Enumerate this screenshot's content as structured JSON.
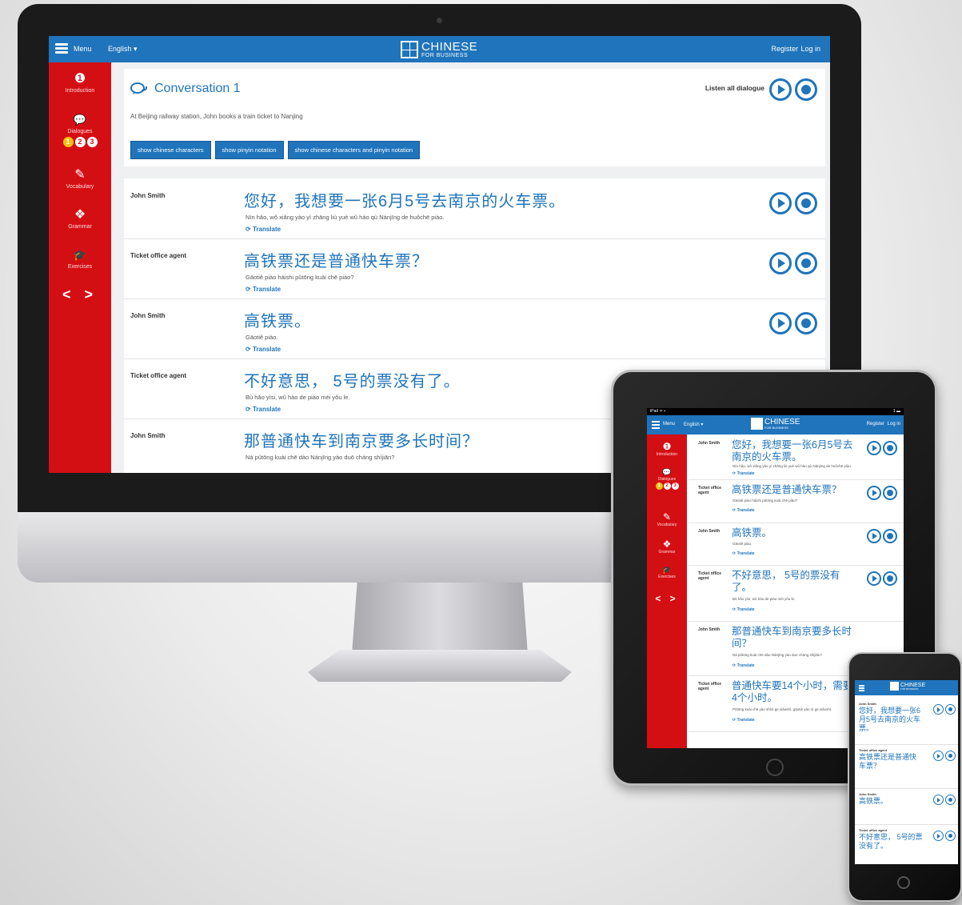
{
  "topbar": {
    "menu_label": "Menu",
    "language": "English ▾",
    "logo_line1": "CHINESE",
    "logo_line2": "FOR BUSINESS",
    "register": "Register",
    "login": "Log in"
  },
  "sidebar": {
    "items": [
      {
        "icon": "info-icon",
        "glyph": "❶",
        "label": "Introduction"
      },
      {
        "icon": "chat-icon",
        "glyph": "💬",
        "label": "Dialogues"
      },
      {
        "icon": "edit-icon",
        "glyph": "✎",
        "label": "Vocabulary"
      },
      {
        "icon": "cubes-icon",
        "glyph": "❖",
        "label": "Grammar"
      },
      {
        "icon": "graduation-cap-icon",
        "glyph": "🎓",
        "label": "Exercises"
      }
    ],
    "dialogue_numbers": [
      "1",
      "2",
      "3"
    ],
    "arrows": "< >"
  },
  "conversation": {
    "title": "Conversation 1",
    "subtitle": "At Beijing railway station, John books a train ticket to Nanjing",
    "listen_all": "Listen all dialogue",
    "buttons": [
      "show chinese characters",
      "show pinyin notation",
      "show chinese characters and pinyin notation"
    ]
  },
  "translate_label": "Translate",
  "dialogue": [
    {
      "speaker": "John Smith",
      "chinese": "您好，我想要一张6月5号去南京的火车票。",
      "pinyin": "Nín hǎo, wǒ xiǎng yào yì zhāng liù yuè wǔ hào qù Nánjīng de huǒchē piào."
    },
    {
      "speaker": "Ticket office agent",
      "chinese": "高铁票还是普通快车票？",
      "pinyin": "Gāotiě piào háishi pǔtōng kuài chē piào?"
    },
    {
      "speaker": "John Smith",
      "chinese": "高铁票。",
      "pinyin": "Gāotiě piào."
    },
    {
      "speaker": "Ticket office agent",
      "chinese": "不好意思， 5号的票没有了。",
      "pinyin": "Bù hǎo yìsi, wǔ hào de piào méi yǒu le."
    },
    {
      "speaker": "John Smith",
      "chinese": "那普通快车到南京要多长时间？",
      "pinyin": "Nà pǔtōng kuài chē dào Nánjīng yào duō cháng shíjiān?"
    }
  ],
  "tablet": {
    "status_left": "iPad ᯤ ▪",
    "status_right": "1 ▬",
    "extra_line": {
      "speaker": "Ticket office agent",
      "chinese": "普通快车要14个小时，需要4个小时。",
      "pinyin": "Pǔtōng kuài chē yào shísì ge xiǎoshí, gāotiě yào sì ge xiǎoshí."
    }
  },
  "phone": {
    "lines": [
      {
        "speaker": "John Smith",
        "chinese": "您好，我想要一张6月5号去南京的火车票。"
      },
      {
        "speaker": "Ticket office agent",
        "chinese": "高铁票还是普通快车票？"
      },
      {
        "speaker": "John Smith",
        "chinese": "高铁票。"
      },
      {
        "speaker": "Ticket office agent",
        "chinese": "不好意思， 5号的票没有了。"
      }
    ]
  }
}
